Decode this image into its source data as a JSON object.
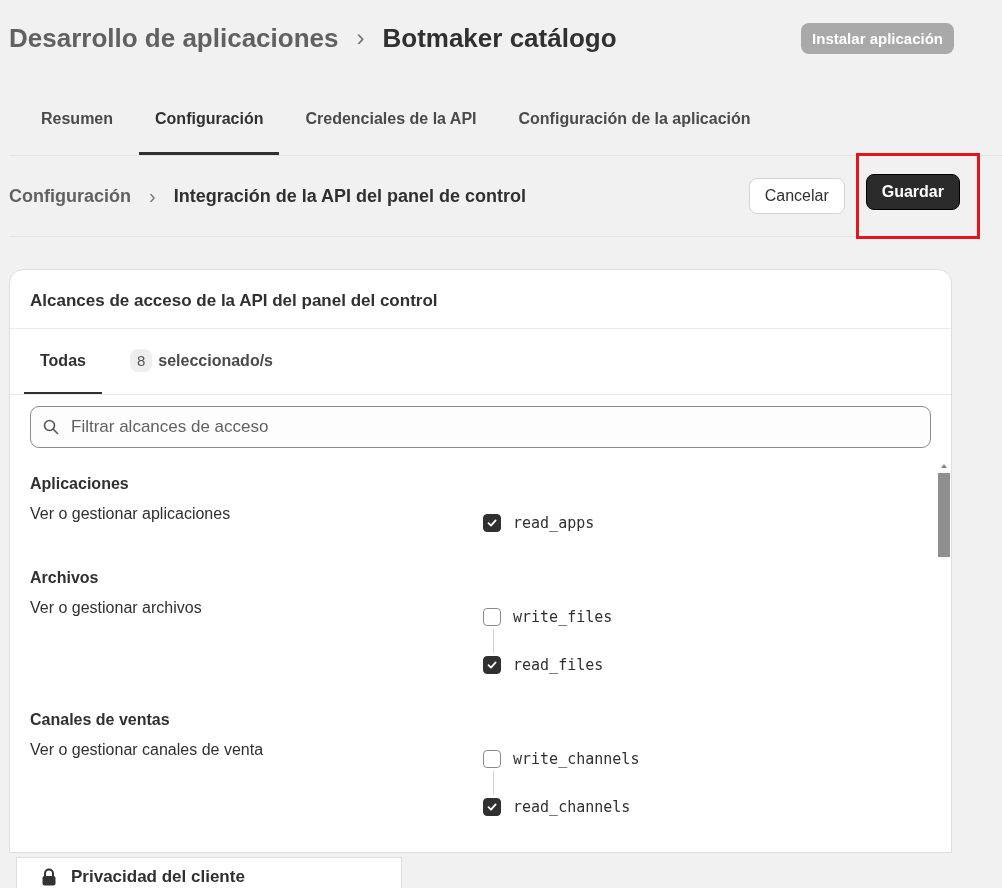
{
  "breadcrumb": {
    "parent": "Desarrollo de aplicaciones",
    "separator": "›",
    "current": "Botmaker catálogo"
  },
  "install_button": {
    "label": "Instalar aplicación",
    "disabled": true
  },
  "tabs": [
    {
      "label": "Resumen",
      "selected": false
    },
    {
      "label": "Configuración",
      "selected": true
    },
    {
      "label": "Credenciales de la API",
      "selected": false
    },
    {
      "label": "Configuración de la aplicación",
      "selected": false
    }
  ],
  "sub_breadcrumb": {
    "parent": "Configuración",
    "separator": "›",
    "current": "Integración de la API del panel de control"
  },
  "buttons": [
    {
      "label": "Cancelar",
      "kind": "secondary"
    },
    {
      "label": "Guardar",
      "kind": "primary"
    }
  ],
  "save_highlight": {
    "shown": true
  },
  "card": {
    "title": "Alcances de acceso de la API del panel del control",
    "tabs": [
      {
        "label": "Todas",
        "selected": true
      },
      {
        "label": "seleccionado/s",
        "count": "8",
        "selected": false
      }
    ],
    "search": {
      "placeholder": "Filtrar alcances de acceso"
    },
    "groups": [
      {
        "title": "Aplicaciones",
        "description": "Ver o gestionar aplicaciones",
        "scopes": [
          {
            "name": "read_apps",
            "checked": true
          }
        ]
      },
      {
        "title": "Archivos",
        "description": "Ver o gestionar archivos",
        "scopes": [
          {
            "name": "write_files",
            "checked": false
          },
          {
            "name": "read_files",
            "checked": true
          }
        ]
      },
      {
        "title": "Canales de ventas",
        "description": "Ver o gestionar canales de venta",
        "scopes": [
          {
            "name": "write_channels",
            "checked": false
          },
          {
            "name": "read_channels",
            "checked": true
          }
        ]
      }
    ]
  },
  "footer_item": {
    "label": "Privacidad del cliente"
  }
}
